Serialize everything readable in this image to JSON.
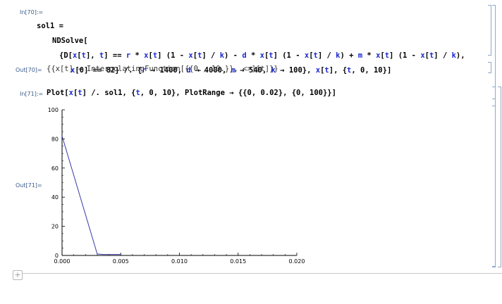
{
  "cells": {
    "in70_label": "In[70]:=",
    "in70_code": {
      "line1_a": "sol1 =",
      "line2_a": "NDSolve[",
      "line3_a": "{D[",
      "line3_b": "x",
      "line3_c": "[",
      "line3_d": "t",
      "line3_e": "], ",
      "line3_f": "t",
      "line3_g": "] == ",
      "line3_h": "r",
      "line3_i": " * ",
      "line3_j": "x",
      "line3_k": "[",
      "line3_l": "t",
      "line3_m": "] (1 - ",
      "line3_n": "x",
      "line3_o": "[",
      "line3_p": "t",
      "line3_q": "] / ",
      "line3_r": "k",
      "line3_s": ") - ",
      "line3_t": "d",
      "line3_u": " * ",
      "line3_v": "x",
      "line3_w": "[",
      "line3_x": "t",
      "line3_y": "] (1 - ",
      "line3_z": "x",
      "line3_aa": "[",
      "line3_ab": "t",
      "line3_ac": "] / ",
      "line3_ad": "k",
      "line3_ae": ") + ",
      "line3_af": "m",
      "line3_ag": " * ",
      "line3_ah": "x",
      "line3_ai": "[",
      "line3_aj": "t",
      "line3_ak": "] (1 - ",
      "line3_al": "x",
      "line3_am": "[",
      "line3_an": "t",
      "line3_ao": "] / ",
      "line3_ap": "k",
      "line3_aq": "),",
      "line4_a": "x",
      "line4_b": "[0] == 82} /. {",
      "line4_c": "r",
      "line4_d": " → 1400, ",
      "line4_e": "d",
      "line4_f": " → 4000, ",
      "line4_g": "m",
      "line4_h": " → 540, ",
      "line4_i": "k",
      "line4_j": " → 100}, ",
      "line4_k": "x",
      "line4_l": "[",
      "line4_m": "t",
      "line4_n": "], {",
      "line4_o": "t",
      "line4_p": ", 0, 10}]"
    },
    "out70_label": "Out[70]=",
    "out70_text": "{{x[t] → InterpolatingFunction[{{0., 10.}}, <>][t]}}",
    "in71_label": "In[71]:=",
    "in71_code": {
      "a": "Plot[",
      "b": "x",
      "c": "[",
      "d": "t",
      "e": "] /. sol1, {",
      "f": "t",
      "g": ", 0, 10}, PlotRange → {{0, 0.02}, {0, 100}}]"
    },
    "out71_label": "Out[71]="
  },
  "add_cell_glyph": "+",
  "chart_data": {
    "type": "line",
    "title": "",
    "xlabel": "",
    "ylabel": "",
    "xlim": [
      0,
      0.02
    ],
    "ylim": [
      0,
      100
    ],
    "x_ticks": [
      "0.000",
      "0.005",
      "0.010",
      "0.015",
      "0.020"
    ],
    "y_ticks": [
      "0",
      "20",
      "40",
      "60",
      "80",
      "100"
    ],
    "series": [
      {
        "x": [
          0.0,
          0.003,
          0.0035,
          0.005
        ],
        "y": [
          82,
          1.0,
          0.7,
          0.7
        ]
      }
    ],
    "line_color": "#3a3aa8",
    "grid": false
  }
}
